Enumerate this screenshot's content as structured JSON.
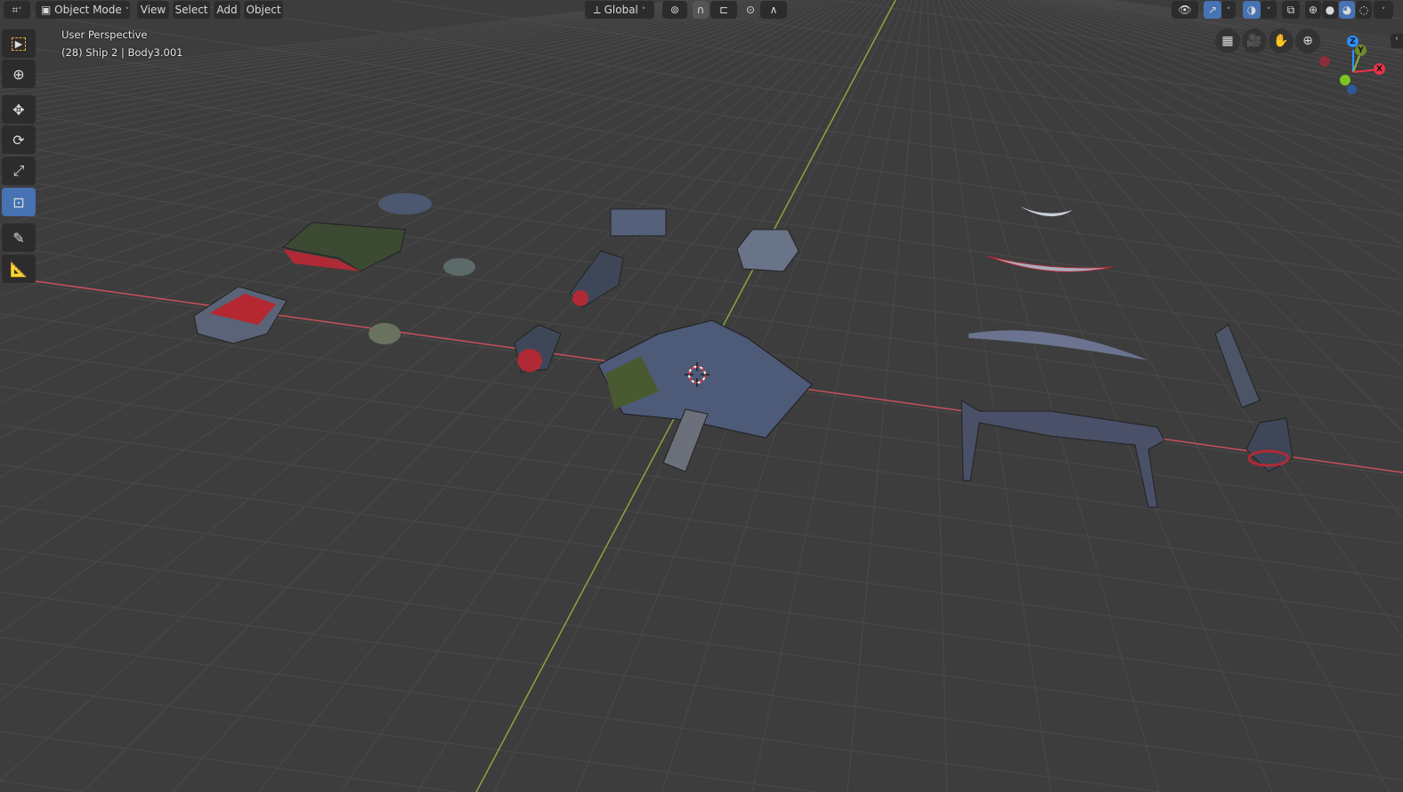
{
  "header": {
    "editor_type_icon": "viewport-icon",
    "mode": "Object Mode",
    "menus": [
      "View",
      "Select",
      "Add",
      "Object"
    ],
    "transform_orientation": "Global"
  },
  "overlay": {
    "view_name": "User Perspective",
    "object_info": "(28) Ship 2 | Body3.001"
  },
  "toolbar": [
    "select-box",
    "cursor",
    "move",
    "rotate",
    "scale",
    "transform",
    "annotate",
    "measure"
  ],
  "active_tool": "transform",
  "colors": {
    "accent": "#4772b3",
    "x_axis": "#d0505a",
    "y_axis": "#8cb43c",
    "z_axis": "#2f8fff",
    "viewport": "#3d3d3d"
  },
  "gizmo": {
    "x": "X",
    "y": "Y",
    "z": "Z"
  }
}
